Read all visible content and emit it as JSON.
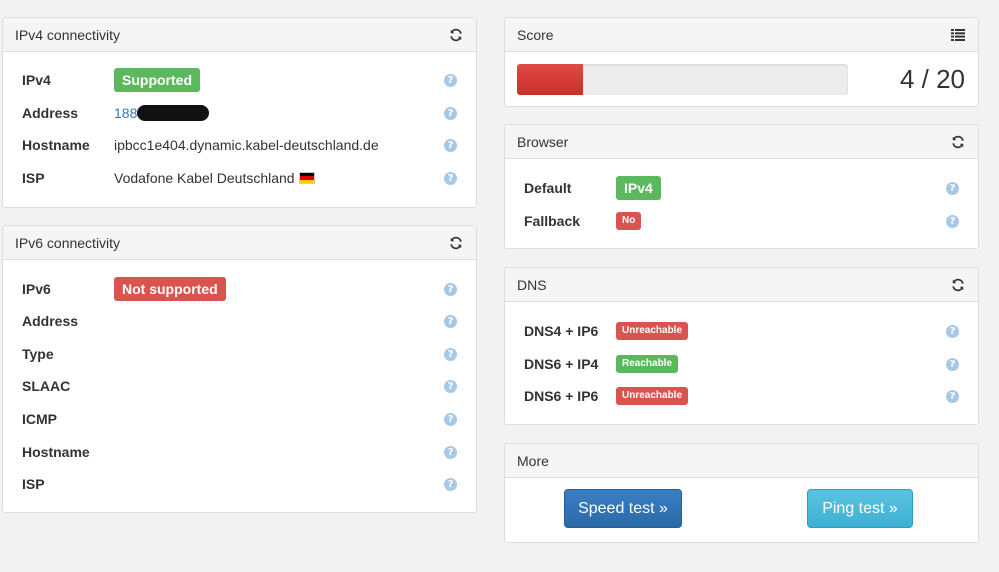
{
  "ipv4": {
    "title": "IPv4 connectivity",
    "rows": [
      {
        "label": "IPv4",
        "badge": "Supported"
      },
      {
        "label": "Address",
        "value": "188"
      },
      {
        "label": "Hostname",
        "value": "ipbcc1e404.dynamic.kabel-deutschland.de"
      },
      {
        "label": "ISP",
        "value": "Vodafone Kabel Deutschland"
      }
    ]
  },
  "ipv6": {
    "title": "IPv6 connectivity",
    "rows": [
      {
        "label": "IPv6",
        "badge": "Not supported"
      },
      {
        "label": "Address"
      },
      {
        "label": "Type"
      },
      {
        "label": "SLAAC"
      },
      {
        "label": "ICMP"
      },
      {
        "label": "Hostname"
      },
      {
        "label": "ISP"
      }
    ]
  },
  "score": {
    "title": "Score",
    "value": "4 / 20",
    "fraction": 0.2,
    "bar_color": "#d9534f"
  },
  "browser": {
    "title": "Browser",
    "rows": [
      {
        "label": "Default",
        "badge": "IPv4"
      },
      {
        "label": "Fallback",
        "badge": "No"
      }
    ]
  },
  "dns": {
    "title": "DNS",
    "rows": [
      {
        "label": "DNS4 + IP6",
        "badge": "Unreachable"
      },
      {
        "label": "DNS6 + IP4",
        "badge": "Reachable"
      },
      {
        "label": "DNS6 + IP6",
        "badge": "Unreachable"
      }
    ]
  },
  "more": {
    "title": "More",
    "speed_test": "Speed test »",
    "ping_test": "Ping test »"
  },
  "colors": {
    "success": "#5cb85c",
    "danger": "#d9534f",
    "link": "#2a7ab8"
  },
  "icons": {
    "refresh": "refresh-icon",
    "list": "list-icon",
    "help": "help-icon",
    "flag": "german-flag-icon"
  }
}
